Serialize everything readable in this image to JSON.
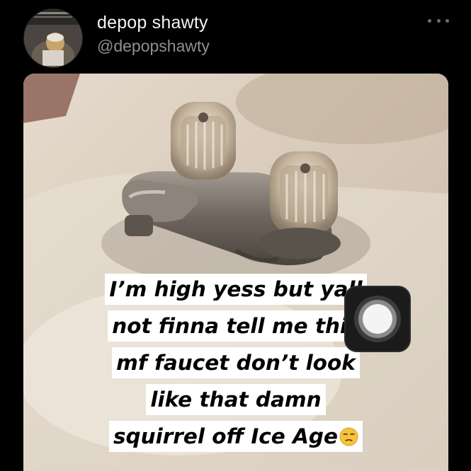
{
  "post": {
    "author_name": "depop shawty",
    "author_handle": "@depopshawty",
    "caption_lines": [
      "I’m high yess but yall",
      "not finna tell me this",
      "mf faucet don’t look",
      "like that damn",
      "squirrel off Ice Age"
    ],
    "caption_emoji": "unamused-face-emoji"
  },
  "icons": {
    "more": "more-horizontal-icon",
    "assistive_touch": "assistive-touch-icon"
  },
  "colors": {
    "background": "#000000",
    "name_text": "#f4f4f4",
    "handle_text": "#8f8f8f",
    "caption_bg": "#ffffff",
    "caption_text": "#000000"
  }
}
